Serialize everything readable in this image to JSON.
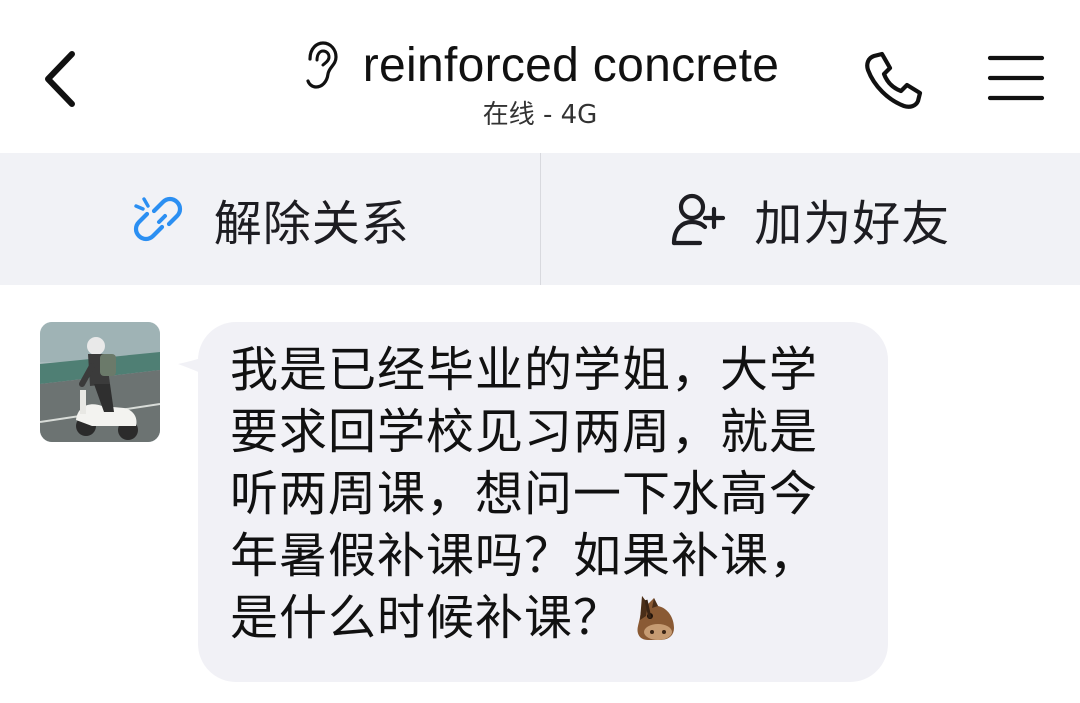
{
  "header": {
    "title": "reinforced concrete",
    "status": "在线 - 4G",
    "icons": {
      "back": "chevron-left-icon",
      "listen": "ear-icon",
      "call": "phone-icon",
      "menu": "hamburger-menu-icon"
    }
  },
  "action_bar": {
    "unlink_label": "解除关系",
    "unlink_icon": "broken-link-icon",
    "add_friend_label": "加为好友",
    "add_friend_icon": "add-user-icon",
    "accent_color": "#2b8ff2"
  },
  "chat": {
    "messages": [
      {
        "sender_avatar": "avatar-scooter-rider",
        "text": "我是已经毕业的学姐，大学要求回学校见习两周，就是听两周课，想问一下水高今年暑假补课吗？如果补课，是什么时候补课？",
        "emoji": "horse-face-emoji"
      }
    ]
  }
}
